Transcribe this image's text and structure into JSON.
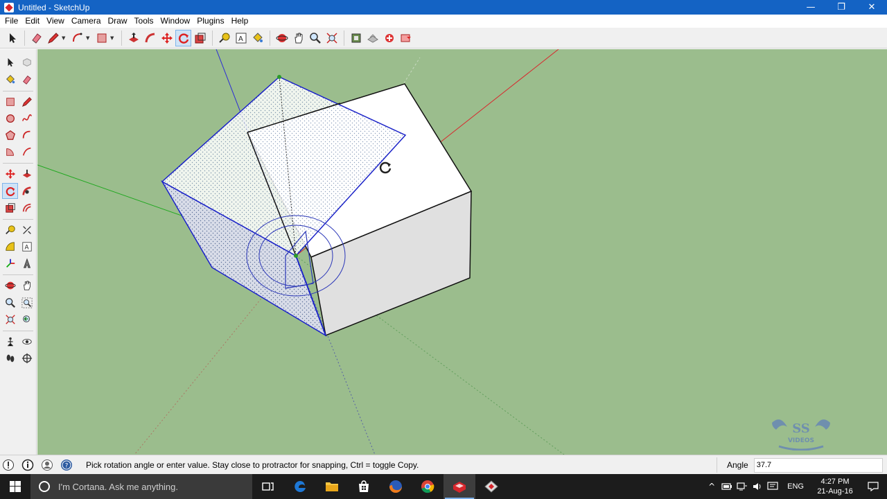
{
  "window": {
    "title": "Untitled - SketchUp",
    "controls": {
      "minimize": "—",
      "maximize": "❐",
      "close": "✕"
    }
  },
  "menu": {
    "items": [
      "File",
      "Edit",
      "View",
      "Camera",
      "Draw",
      "Tools",
      "Window",
      "Plugins",
      "Help"
    ]
  },
  "toolbar": {
    "active_tool": "rotate-icon",
    "icons": [
      "select-icon",
      "eraser-icon",
      "pencil-icon",
      "arc-icon",
      "rectangle-icon",
      "push-pull-icon",
      "follow-me-icon",
      "move-icon",
      "rotate-icon",
      "scale-icon",
      "tape-measure-icon",
      "text-icon",
      "paint-bucket-icon",
      "orbit-icon",
      "pan-icon",
      "zoom-icon",
      "zoom-extents-icon",
      "warehouse-icon",
      "extension-icon",
      "components-icon",
      "share-icon"
    ]
  },
  "palette": {
    "active_tool": "rotate-icon"
  },
  "viewport": {
    "background": "#9bbd8d",
    "axis_colors": {
      "red": "#d9262c",
      "green": "#1fa81f",
      "blue": "#2b2bd6"
    },
    "watermark": {
      "line1": "SS",
      "line2": "VIDEOS"
    }
  },
  "status": {
    "message": "Pick rotation angle or enter value.  Stay close to protractor for snapping, Ctrl = toggle Copy.",
    "vcb_label": "Angle",
    "vcb_value": "37.7"
  },
  "taskbar": {
    "cortana_placeholder": "I'm Cortana. Ask me anything.",
    "apps": [
      "task-view-icon",
      "edge-icon",
      "file-explorer-icon",
      "store-icon",
      "firefox-icon",
      "chrome-icon",
      "sketchup-icon",
      "sketchup-viewer-icon"
    ],
    "active_app": "sketchup-icon",
    "tray": {
      "chevron": "^",
      "language": "ENG"
    },
    "clock": {
      "time": "4:27 PM",
      "date": "21-Aug-16"
    }
  }
}
